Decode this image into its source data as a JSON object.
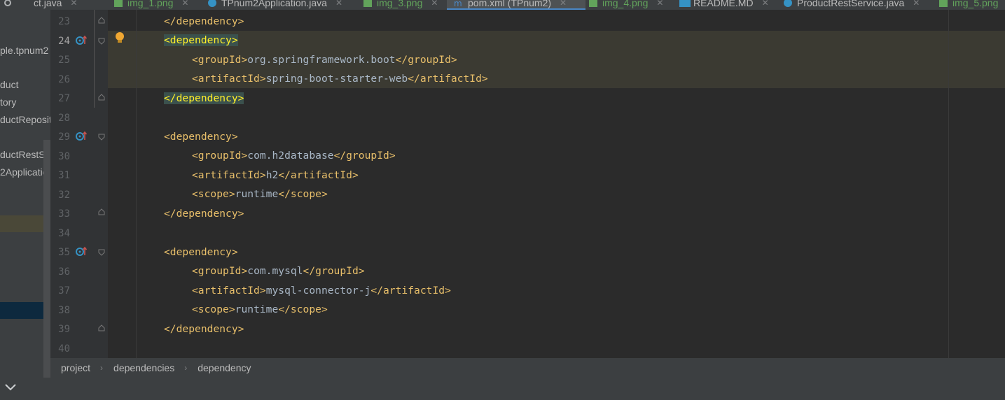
{
  "tabs": [
    {
      "label": "ct.java",
      "kind": "java"
    },
    {
      "label": "img_1.png",
      "kind": "png"
    },
    {
      "label": "TPnum2Application.java",
      "kind": "java"
    },
    {
      "label": "img_3.png",
      "kind": "png"
    },
    {
      "label": "pom.xml (TPnum2)",
      "kind": "xml",
      "active": true
    },
    {
      "label": "img_4.png",
      "kind": "png"
    },
    {
      "label": "README.MD",
      "kind": "md"
    },
    {
      "label": "ProductRestService.java",
      "kind": "java"
    },
    {
      "label": "img_5.png",
      "kind": "png"
    }
  ],
  "project_tree": [
    "ple.tpnum2",
    "duct",
    "tory",
    "ductReposit",
    "ductRestSer",
    "2Applicatio"
  ],
  "line_numbers": [
    "23",
    "24",
    "25",
    "26",
    "27",
    "28",
    "29",
    "30",
    "31",
    "32",
    "33",
    "34",
    "35",
    "36",
    "37",
    "38",
    "39",
    "40"
  ],
  "code": {
    "l23": {
      "open": "</dependency>"
    },
    "l24": {
      "open": "<dependency>"
    },
    "l25": {
      "open": "<groupId>",
      "value": "org.springframework.boot",
      "close": "</groupId>"
    },
    "l26": {
      "open": "<artifactId>",
      "value": "spring-boot-starter-web",
      "close": "</artifactId>"
    },
    "l27": {
      "open": "</dependency>"
    },
    "l29": {
      "open": "<dependency>"
    },
    "l30": {
      "open": "<groupId>",
      "value": "com.h2database",
      "close": "</groupId>"
    },
    "l31": {
      "open": "<artifactId>",
      "value": "h2",
      "close": "</artifactId>"
    },
    "l32": {
      "open": "<scope>",
      "value": "runtime",
      "close": "</scope>"
    },
    "l33": {
      "open": "</dependency>"
    },
    "l35": {
      "open": "<dependency>"
    },
    "l36": {
      "open": "<groupId>",
      "value": "com.mysql",
      "close": "</groupId>"
    },
    "l37": {
      "open": "<artifactId>",
      "value": "mysql-connector-j",
      "close": "</artifactId>"
    },
    "l38": {
      "open": "<scope>",
      "value": "runtime",
      "close": "</scope>"
    },
    "l39": {
      "open": "</dependency>"
    }
  },
  "breadcrumb": [
    "project",
    "dependencies",
    "dependency"
  ],
  "colors": {
    "tag": "#e8bf6a",
    "text": "#a9b7c6",
    "highlight": "#3b3a32",
    "bulb": "#f0a732"
  },
  "icons": {
    "bulb": "lightbulb-icon",
    "gutter": "maven-override-icon",
    "chevron": "chevron-down-icon"
  }
}
